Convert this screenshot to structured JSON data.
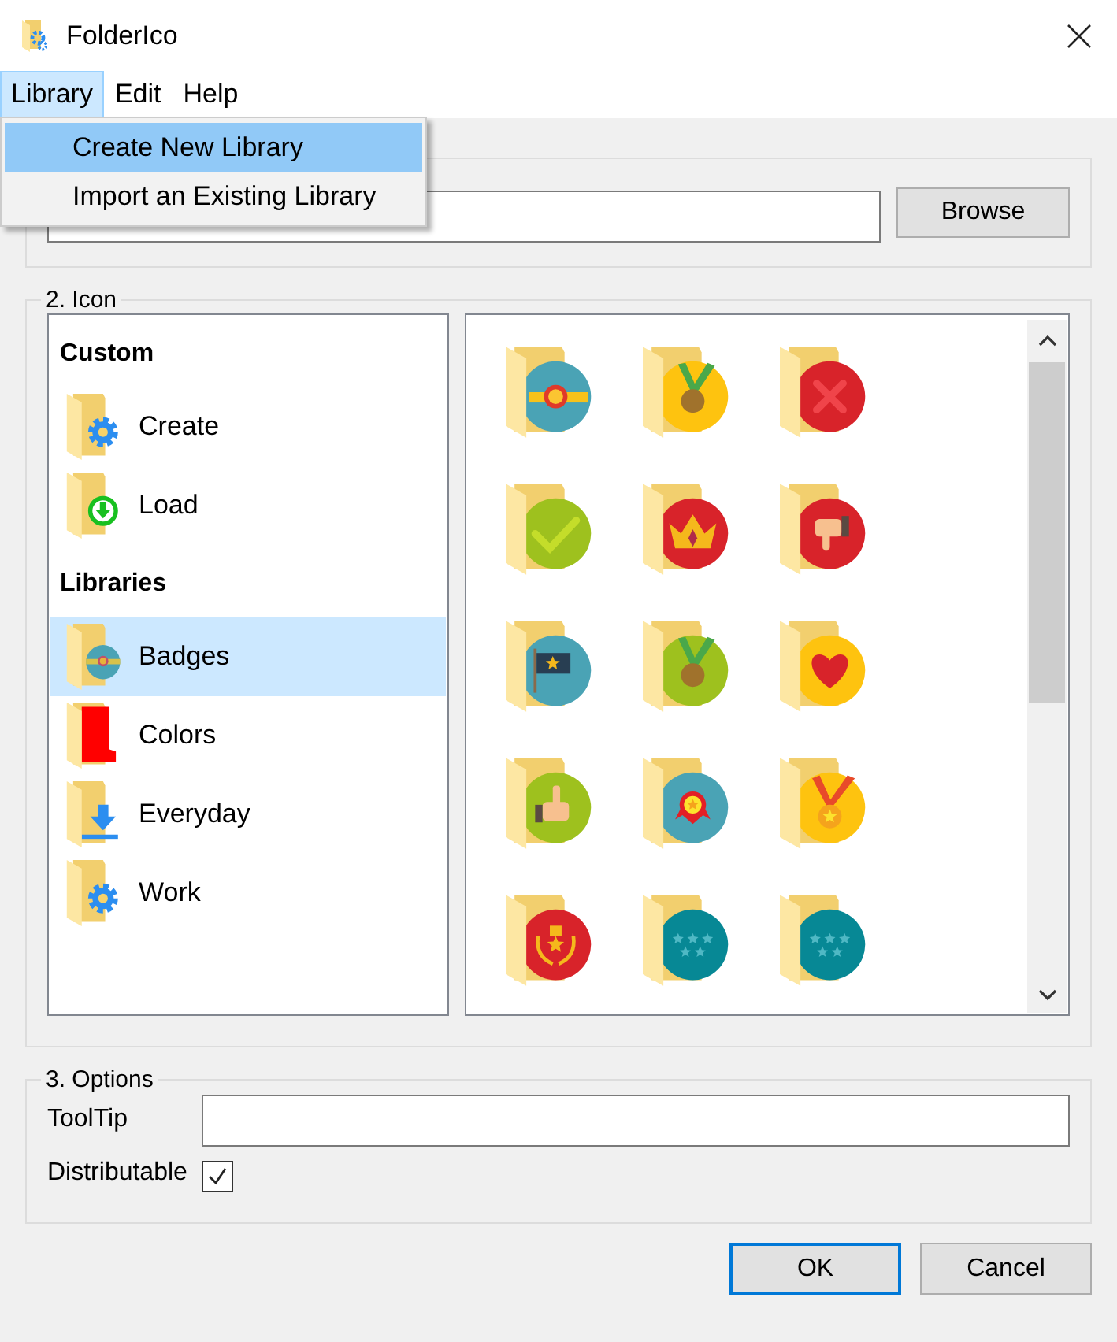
{
  "window": {
    "title": "FolderIco"
  },
  "menus": [
    {
      "label": "Library",
      "selected": true
    },
    {
      "label": "Edit",
      "selected": false
    },
    {
      "label": "Help",
      "selected": false
    }
  ],
  "dropdown": [
    {
      "label": "Create New Library",
      "selected": true
    },
    {
      "label": "Import an Existing Library",
      "selected": false
    }
  ],
  "folder_group": {
    "button": "Browse"
  },
  "icon_group": {
    "title": "2. Icon",
    "sections": [
      {
        "title": "Custom",
        "items": [
          {
            "label": "Create",
            "kind": "gear",
            "selected": false
          },
          {
            "label": "Load",
            "kind": "download",
            "selected": false
          }
        ]
      },
      {
        "title": "Libraries",
        "items": [
          {
            "label": "Badges",
            "kind": "badge",
            "selected": true
          },
          {
            "label": "Colors",
            "kind": "red-panel",
            "selected": false
          },
          {
            "label": "Everyday",
            "kind": "arrow-down",
            "selected": false
          },
          {
            "label": "Work",
            "kind": "gear",
            "selected": false
          }
        ]
      }
    ],
    "icons": [
      {
        "kind": "rosette",
        "color": "#4aa3b5"
      },
      {
        "kind": "medal",
        "color": "#fec30f"
      },
      {
        "kind": "cross",
        "color": "#d8232a"
      },
      {
        "kind": "check",
        "color": "#9ec11e"
      },
      {
        "kind": "crown",
        "color": "#d8232a"
      },
      {
        "kind": "thumb-down",
        "color": "#d8232a"
      },
      {
        "kind": "flag",
        "color": "#4aa3b5"
      },
      {
        "kind": "medal",
        "color": "#9ec11e"
      },
      {
        "kind": "heart",
        "color": "#fec30f"
      },
      {
        "kind": "thumb-up",
        "color": "#9ec11e"
      },
      {
        "kind": "ribbon",
        "color": "#4aa3b5"
      },
      {
        "kind": "star-medal",
        "color": "#fec30f"
      },
      {
        "kind": "laurel",
        "color": "#d8232a"
      },
      {
        "kind": "stars",
        "color": "#078895"
      },
      {
        "kind": "stars",
        "color": "#078895"
      }
    ]
  },
  "options": {
    "title": "3. Options",
    "tooltip_label": "ToolTip",
    "checkbox": {
      "label": "Distributable",
      "checked": true
    }
  },
  "buttons": [
    {
      "label": "OK",
      "default": true
    },
    {
      "label": "Cancel",
      "default": false
    }
  ]
}
